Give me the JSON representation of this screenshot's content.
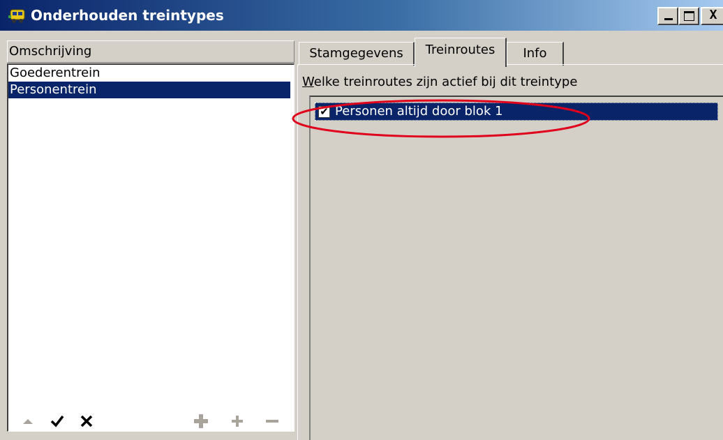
{
  "window": {
    "title": "Onderhouden treintypes",
    "icon": "train-icon",
    "buttons": {
      "minimize": "_",
      "maximize": "□",
      "close": "X"
    }
  },
  "left": {
    "column_header": "Omschrijving",
    "items": [
      {
        "label": "Goederentrein",
        "selected": false
      },
      {
        "label": "Personentrein",
        "selected": true
      }
    ],
    "toolbar": [
      "move-up-icon",
      "check-icon",
      "cross-icon",
      "move-icon",
      "plus-icon",
      "minus-icon"
    ]
  },
  "right": {
    "tabs": [
      {
        "label": "Stamgegevens",
        "active": false
      },
      {
        "label": "Treinroutes",
        "active": true
      },
      {
        "label": "Info",
        "active": false
      }
    ],
    "label_prefix": "W",
    "label_rest": "elke treinroutes zijn actief bij dit treintype",
    "routes": [
      {
        "label": "Personen altijd door blok 1",
        "checked": true,
        "check_glyph": "✔"
      }
    ]
  },
  "colors": {
    "selection": "#0a246a",
    "face": "#d4d0c8",
    "annotation": "#e0001b"
  }
}
